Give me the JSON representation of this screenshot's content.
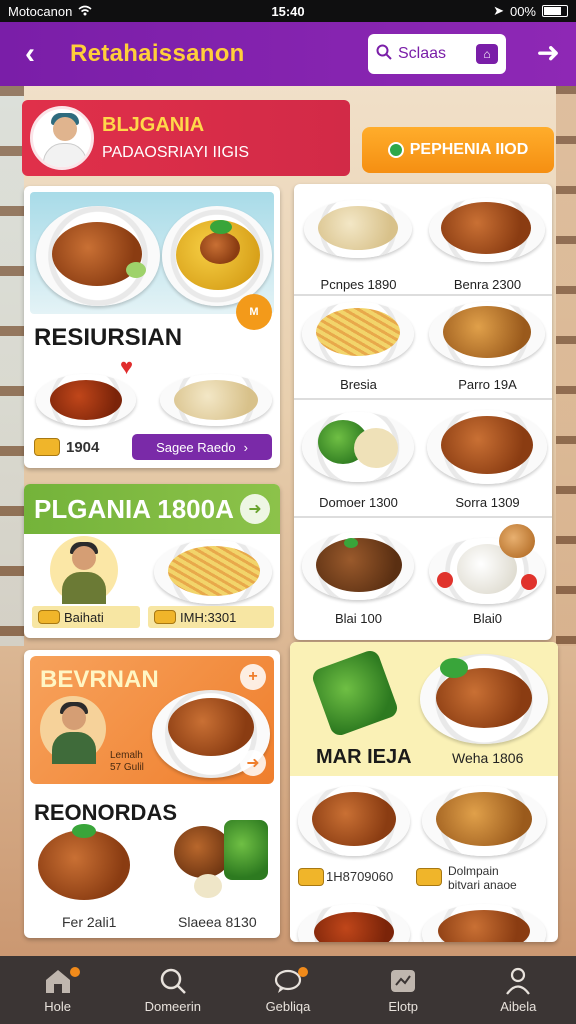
{
  "status_bar": {
    "carrier": "Motocanon",
    "time": "15:40",
    "battery": "00%"
  },
  "header": {
    "title": "Retahaissanon",
    "search_label": "Sclaas"
  },
  "profile": {
    "name": "BLJGANIA",
    "subtitle": "PADAOSRIAYI IIGIS"
  },
  "promo": {
    "label": "PEPHENIA IIOD"
  },
  "card_resiursian": {
    "title": "RESIURSIAN",
    "badge": "M",
    "price": "1904",
    "button_label": "Sagee Raedo"
  },
  "card_plgania": {
    "title": "PLGANIA 1800A",
    "tag1": "Baihati",
    "tag2": "IMH:3301"
  },
  "card_bevrnan": {
    "title": "BEVRNAN",
    "sub1": "Lemalh",
    "sub2": "57 Gulil",
    "title2": "REONORDAS",
    "item1": "Fer 2ali1",
    "item2": "Slaeea 8130"
  },
  "grid_items": [
    {
      "label": "Pcnpes 1890"
    },
    {
      "label": "Benra 2300"
    },
    {
      "label": "Bresia"
    },
    {
      "label": "Parro 19A"
    },
    {
      "label": "Domoer 1300"
    },
    {
      "label": "Sorra 1309"
    },
    {
      "label": "Blai 100"
    },
    {
      "label": "Blai0"
    }
  ],
  "card_marieja": {
    "title": "MAR IEJA",
    "price": "Weha 1806",
    "price2": "1H8709060",
    "desc1": "Dolmpain",
    "desc2": "bitvari anaoe"
  },
  "tabs": [
    {
      "label": "Hole",
      "icon": "home-icon"
    },
    {
      "label": "Domeerin",
      "icon": "search-icon"
    },
    {
      "label": "Gebliqa",
      "icon": "chat-icon"
    },
    {
      "label": "Elotp",
      "icon": "tag-icon"
    },
    {
      "label": "Aibela",
      "icon": "user-icon"
    }
  ],
  "colors": {
    "header": "#7a1ea8",
    "title_accent": "#ffcf3a",
    "banner_red": "#e0304a",
    "promo_orange": "#f58f12",
    "green": "#74b33a",
    "tabbar": "#3b3534"
  }
}
